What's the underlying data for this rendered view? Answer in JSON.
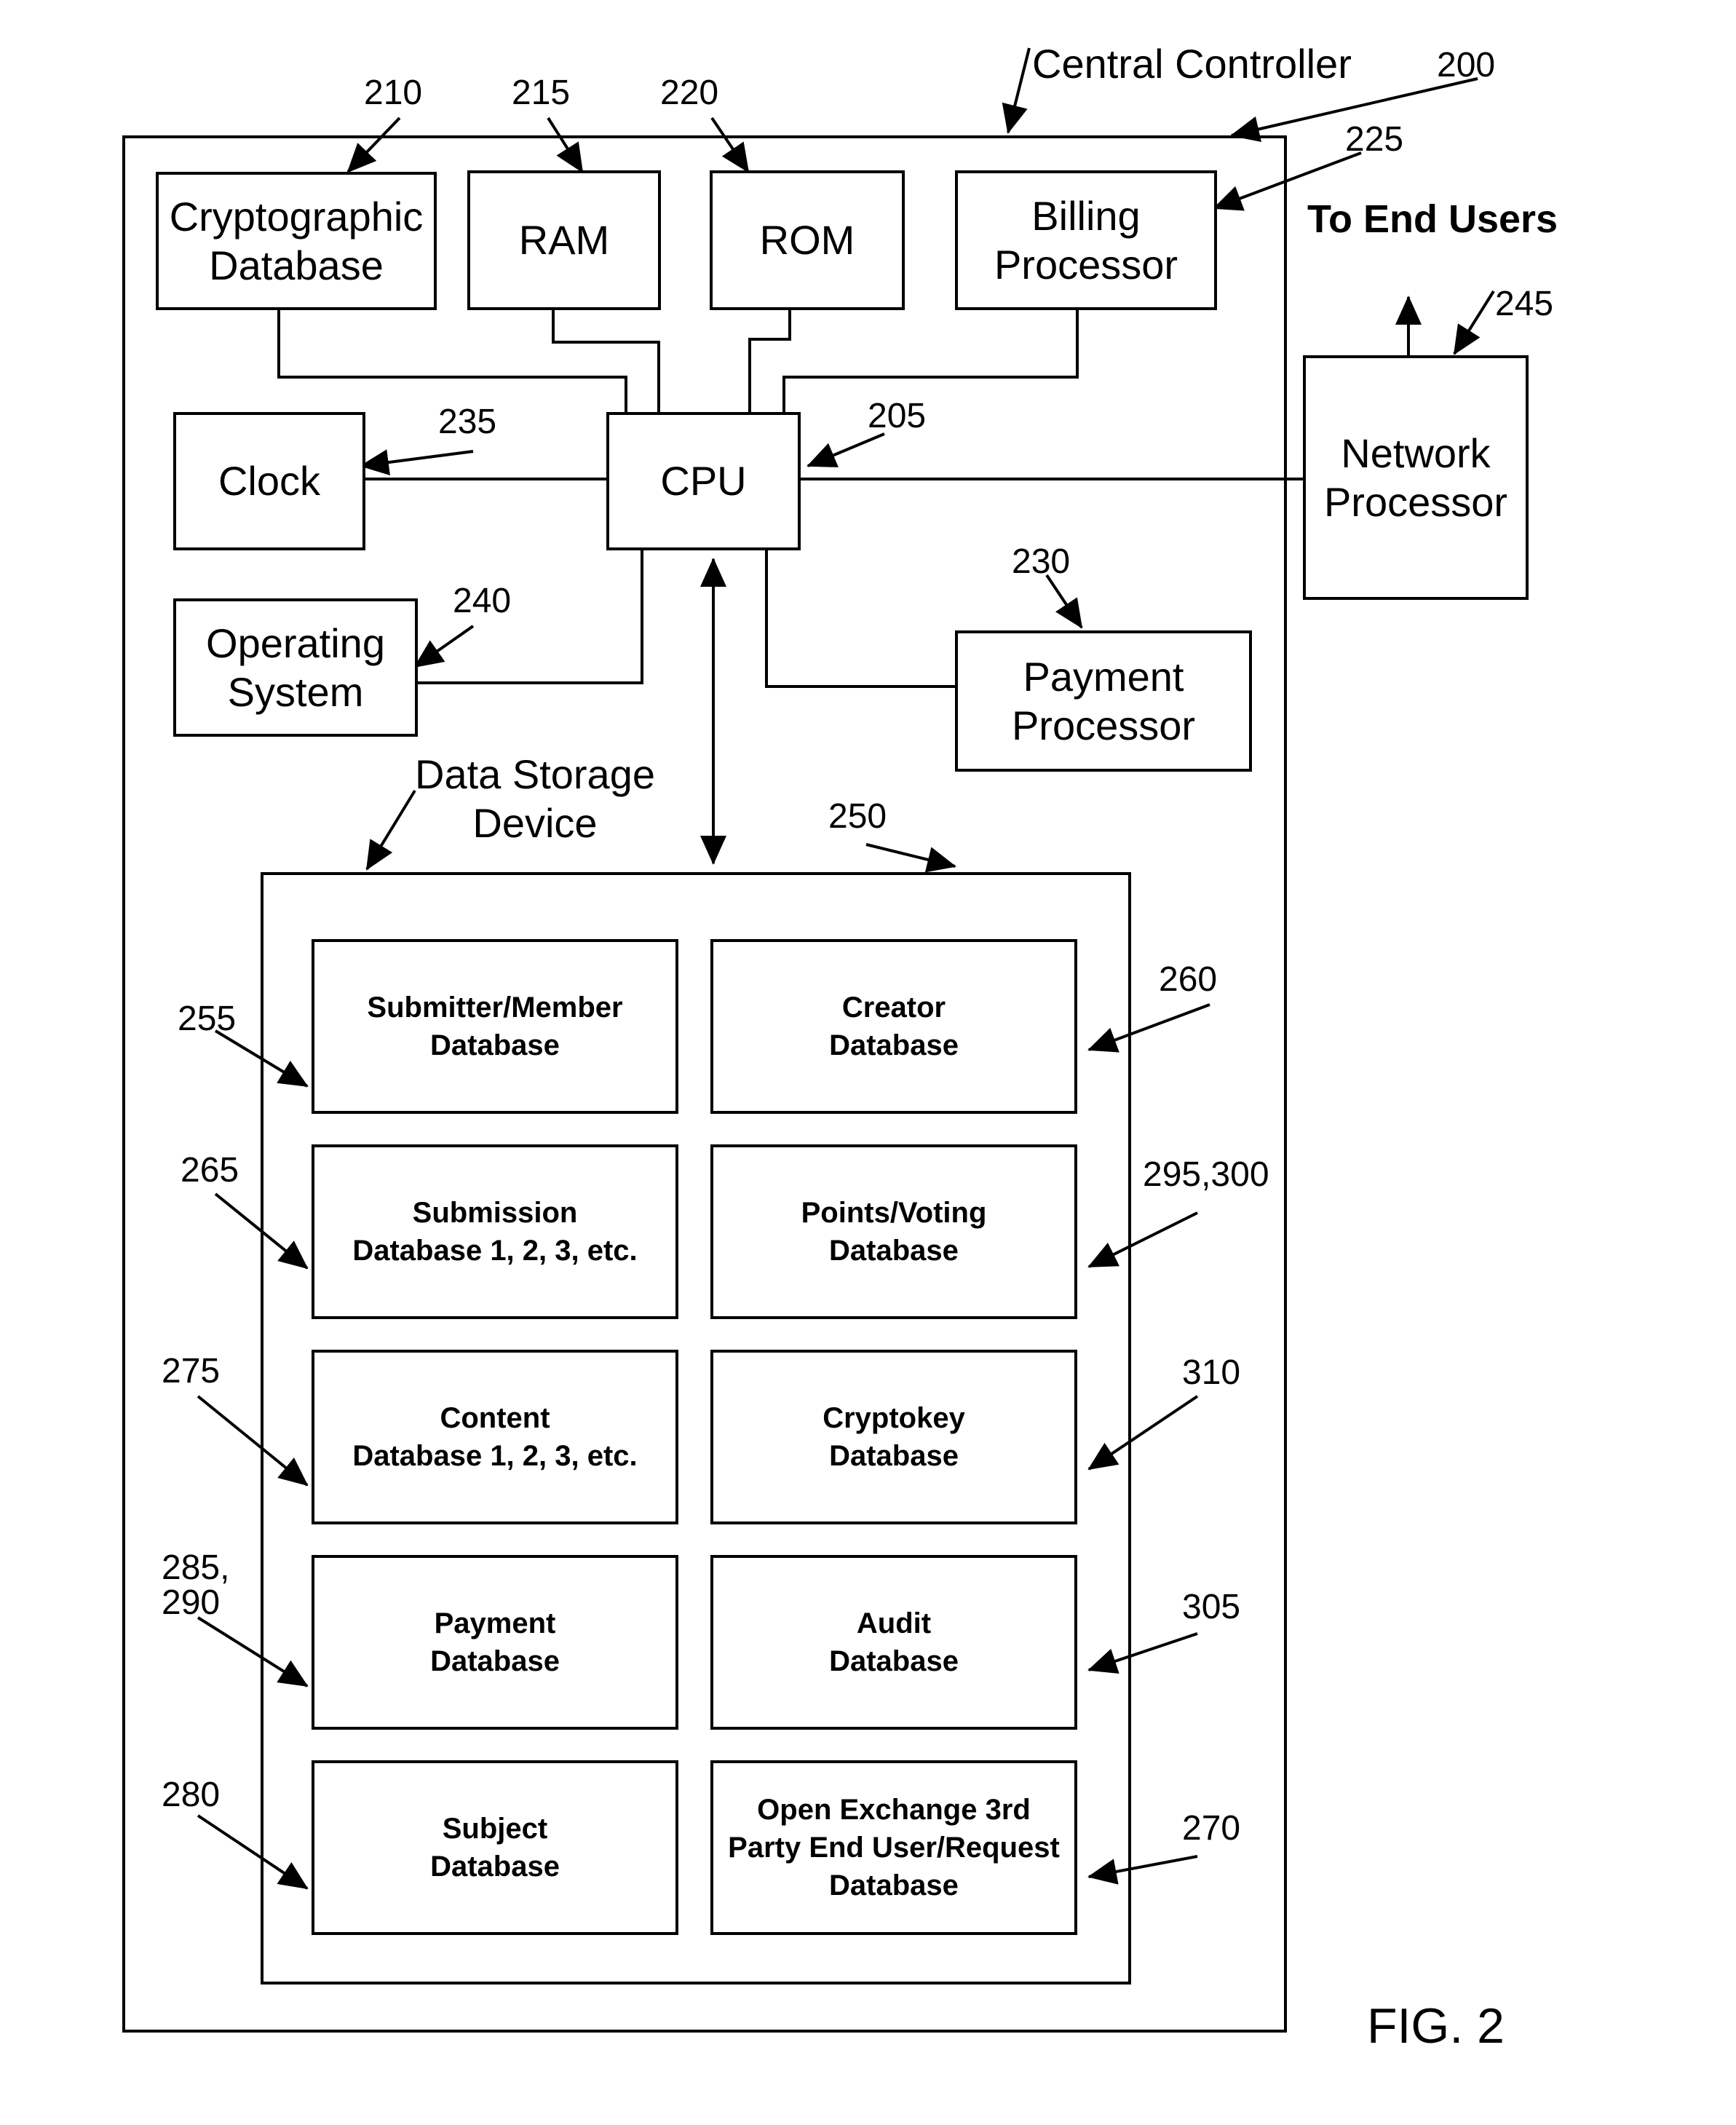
{
  "figure": {
    "label": "FIG. 2",
    "title": "Central Controller",
    "title_ref": "200",
    "external_label": "To End Users"
  },
  "components": {
    "crypto_db": {
      "label": "Cryptographic\nDatabase",
      "ref": "210"
    },
    "ram": {
      "label": "RAM",
      "ref": "215"
    },
    "rom": {
      "label": "ROM",
      "ref": "220"
    },
    "billing": {
      "label": "Billing\nProcessor",
      "ref": "225"
    },
    "clock": {
      "label": "Clock",
      "ref": "235"
    },
    "cpu": {
      "label": "CPU",
      "ref": "205"
    },
    "os": {
      "label": "Operating\nSystem",
      "ref": "240"
    },
    "payment_processor": {
      "label": "Payment\nProcessor",
      "ref": "230"
    },
    "network_processor": {
      "label": "Network\nProcessor",
      "ref": "245"
    }
  },
  "data_storage": {
    "label": "Data Storage\nDevice",
    "ref": "250",
    "databases": [
      {
        "label": "Submitter/Member\nDatabase",
        "ref": "255",
        "side": "left"
      },
      {
        "label": "Creator\nDatabase",
        "ref": "260",
        "side": "right"
      },
      {
        "label": "Submission\nDatabase 1, 2, 3, etc.",
        "ref": "265",
        "side": "left"
      },
      {
        "label": "Points/Voting\nDatabase",
        "ref": "295,300",
        "side": "right"
      },
      {
        "label": "Content\nDatabase 1, 2, 3, etc.",
        "ref": "275",
        "side": "left"
      },
      {
        "label": "Cryptokey\nDatabase",
        "ref": "310",
        "side": "right"
      },
      {
        "label": "Payment\nDatabase",
        "ref": "285,\n290",
        "side": "left"
      },
      {
        "label": "Audit\nDatabase",
        "ref": "305",
        "side": "right"
      },
      {
        "label": "Subject\nDatabase",
        "ref": "280",
        "side": "left"
      },
      {
        "label": "Open Exchange 3rd\nParty End User/Request\nDatabase",
        "ref": "270",
        "side": "right"
      }
    ]
  }
}
